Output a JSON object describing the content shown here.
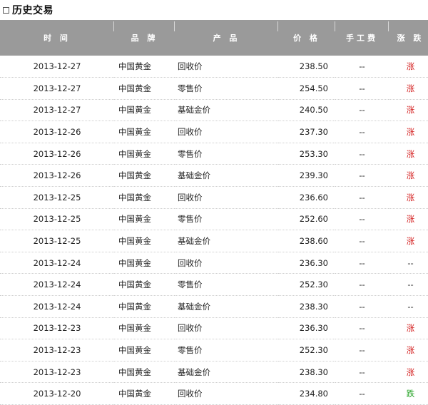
{
  "section_title": "历史交易",
  "columns": {
    "time": "时 间",
    "brand": "品 牌",
    "product": "产 品",
    "price": "价 格",
    "fee": "手工费",
    "change": "涨 跌"
  },
  "rows": [
    {
      "date": "2013-12-27",
      "brand": "中国黄金",
      "product": "回收价",
      "price": "238.50",
      "fee": "--",
      "change": "涨",
      "dir": "up"
    },
    {
      "date": "2013-12-27",
      "brand": "中国黄金",
      "product": "零售价",
      "price": "254.50",
      "fee": "--",
      "change": "涨",
      "dir": "up"
    },
    {
      "date": "2013-12-27",
      "brand": "中国黄金",
      "product": "基础金价",
      "price": "240.50",
      "fee": "--",
      "change": "涨",
      "dir": "up"
    },
    {
      "date": "2013-12-26",
      "brand": "中国黄金",
      "product": "回收价",
      "price": "237.30",
      "fee": "--",
      "change": "涨",
      "dir": "up"
    },
    {
      "date": "2013-12-26",
      "brand": "中国黄金",
      "product": "零售价",
      "price": "253.30",
      "fee": "--",
      "change": "涨",
      "dir": "up"
    },
    {
      "date": "2013-12-26",
      "brand": "中国黄金",
      "product": "基础金价",
      "price": "239.30",
      "fee": "--",
      "change": "涨",
      "dir": "up"
    },
    {
      "date": "2013-12-25",
      "brand": "中国黄金",
      "product": "回收价",
      "price": "236.60",
      "fee": "--",
      "change": "涨",
      "dir": "up"
    },
    {
      "date": "2013-12-25",
      "brand": "中国黄金",
      "product": "零售价",
      "price": "252.60",
      "fee": "--",
      "change": "涨",
      "dir": "up"
    },
    {
      "date": "2013-12-25",
      "brand": "中国黄金",
      "product": "基础金价",
      "price": "238.60",
      "fee": "--",
      "change": "涨",
      "dir": "up"
    },
    {
      "date": "2013-12-24",
      "brand": "中国黄金",
      "product": "回收价",
      "price": "236.30",
      "fee": "--",
      "change": "--",
      "dir": "flat"
    },
    {
      "date": "2013-12-24",
      "brand": "中国黄金",
      "product": "零售价",
      "price": "252.30",
      "fee": "--",
      "change": "--",
      "dir": "flat"
    },
    {
      "date": "2013-12-24",
      "brand": "中国黄金",
      "product": "基础金价",
      "price": "238.30",
      "fee": "--",
      "change": "--",
      "dir": "flat"
    },
    {
      "date": "2013-12-23",
      "brand": "中国黄金",
      "product": "回收价",
      "price": "236.30",
      "fee": "--",
      "change": "涨",
      "dir": "up"
    },
    {
      "date": "2013-12-23",
      "brand": "中国黄金",
      "product": "零售价",
      "price": "252.30",
      "fee": "--",
      "change": "涨",
      "dir": "up"
    },
    {
      "date": "2013-12-23",
      "brand": "中国黄金",
      "product": "基础金价",
      "price": "238.30",
      "fee": "--",
      "change": "涨",
      "dir": "up"
    },
    {
      "date": "2013-12-20",
      "brand": "中国黄金",
      "product": "回收价",
      "price": "234.80",
      "fee": "--",
      "change": "跌",
      "dir": "down"
    }
  ]
}
